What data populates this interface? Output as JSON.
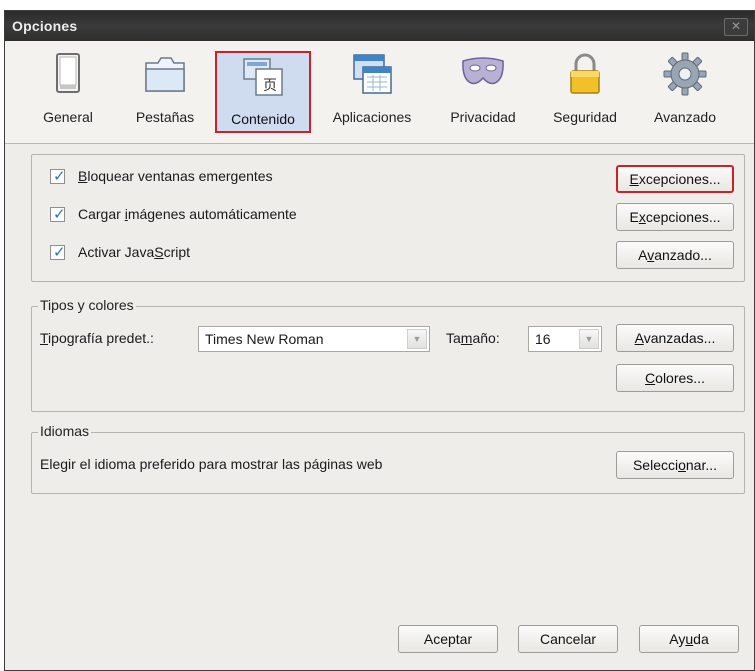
{
  "window": {
    "title": "Opciones",
    "close_glyph": "✕"
  },
  "tabs": [
    {
      "label": "General",
      "icon": "general-icon"
    },
    {
      "label": "Pestañas",
      "icon": "tabs-icon"
    },
    {
      "label": "Contenido",
      "icon": "content-icon",
      "selected": true
    },
    {
      "label": "Aplicaciones",
      "icon": "applications-icon"
    },
    {
      "label": "Privacidad",
      "icon": "privacy-mask-icon"
    },
    {
      "label": "Seguridad",
      "icon": "security-lock-icon"
    },
    {
      "label": "Avanzado",
      "icon": "advanced-gear-icon"
    }
  ],
  "content": {
    "popups": {
      "checked": true,
      "pre": "",
      "accel": "B",
      "post": "loquear ventanas emergentes"
    },
    "images": {
      "checked": true,
      "pre": "Cargar ",
      "accel": "i",
      "post": "mágenes automáticamente"
    },
    "javascript": {
      "checked": true,
      "pre": "Activar Java",
      "accel": "S",
      "post": "cript"
    },
    "exceptions1": {
      "pre": "",
      "accel": "E",
      "post": "xcepciones..."
    },
    "exceptions2": {
      "pre": "E",
      "accel": "x",
      "post": "cepciones..."
    },
    "advanced_js": {
      "pre": "A",
      "accel": "v",
      "post": "anzado..."
    }
  },
  "fonts": {
    "legend": "Tipos y colores",
    "default_font_label": {
      "pre": "",
      "accel": "T",
      "post": "ipografía predet.:"
    },
    "default_font_value": "Times New Roman",
    "size_label": {
      "pre": "Ta",
      "accel": "m",
      "post": "año:"
    },
    "size_value": "16",
    "advanced_button": {
      "pre": "",
      "accel": "A",
      "post": "vanzadas..."
    },
    "colors_button": {
      "pre": "",
      "accel": "C",
      "post": "olores..."
    }
  },
  "languages": {
    "legend": "Idiomas",
    "description": "Elegir el idioma preferido para mostrar las páginas web",
    "choose_button": {
      "pre": "Selecci",
      "accel": "o",
      "post": "nar..."
    }
  },
  "footer": {
    "ok": "Aceptar",
    "cancel": "Cancelar",
    "help": {
      "pre": "Ay",
      "accel": "u",
      "post": "da"
    }
  },
  "colors": {
    "focus_outline": "#d02027",
    "check": "#2f6fc2",
    "selected_tab_bg": "#cfdcf0"
  }
}
